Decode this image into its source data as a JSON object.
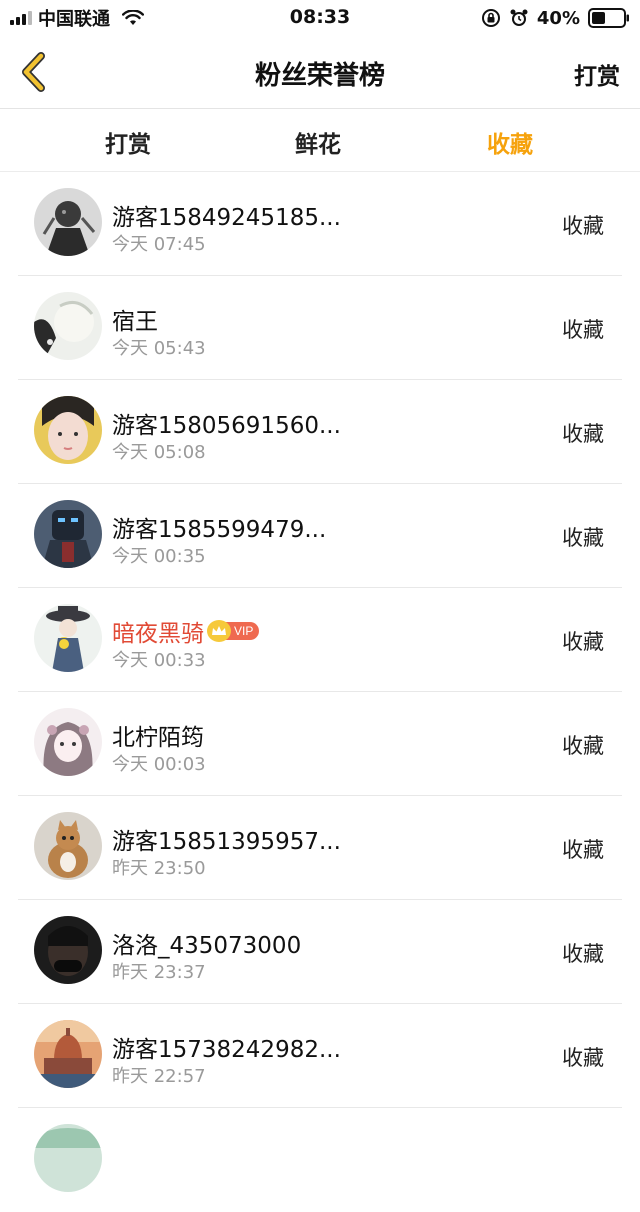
{
  "status_bar": {
    "carrier": "中国联通",
    "time": "08:33",
    "battery_percent": "40%"
  },
  "nav": {
    "title": "粉丝荣誉榜",
    "right_action": "打赏"
  },
  "tabs": [
    {
      "label": "打赏",
      "active": false
    },
    {
      "label": "鲜花",
      "active": false
    },
    {
      "label": "收藏",
      "active": true
    }
  ],
  "colors": {
    "accent": "#f6a20c",
    "vip_name": "#e14a35",
    "back_arrow": "#f2c230"
  },
  "list": [
    {
      "name": "游客15849245185...",
      "time": "今天 07:45",
      "action": "收藏",
      "vip": false,
      "avatar": "avatar-dark-warrior"
    },
    {
      "name": "宿王",
      "time": "今天 05:43",
      "action": "收藏",
      "vip": false,
      "avatar": "avatar-white-hair"
    },
    {
      "name": "游客15805691560...",
      "time": "今天 05:08",
      "action": "收藏",
      "vip": false,
      "avatar": "avatar-girl-face"
    },
    {
      "name": "游客1585599479...",
      "time": "今天 00:35",
      "action": "收藏",
      "vip": false,
      "avatar": "avatar-robot"
    },
    {
      "name": "暗夜黑骑",
      "time": "今天 00:33",
      "action": "收藏",
      "vip": true,
      "vip_label": "VIP",
      "avatar": "avatar-hat-figure"
    },
    {
      "name": "北柠陌筠",
      "time": "今天 00:03",
      "action": "收藏",
      "vip": false,
      "avatar": "avatar-anime-girl"
    },
    {
      "name": "游客15851395957...",
      "time": "昨天 23:50",
      "action": "收藏",
      "vip": false,
      "avatar": "avatar-cat"
    },
    {
      "name": "洛洛_435073000",
      "time": "昨天 23:37",
      "action": "收藏",
      "vip": false,
      "avatar": "avatar-dark-person"
    },
    {
      "name": "游客15738242982...",
      "time": "昨天 22:57",
      "action": "收藏",
      "vip": false,
      "avatar": "avatar-cathedral"
    }
  ]
}
